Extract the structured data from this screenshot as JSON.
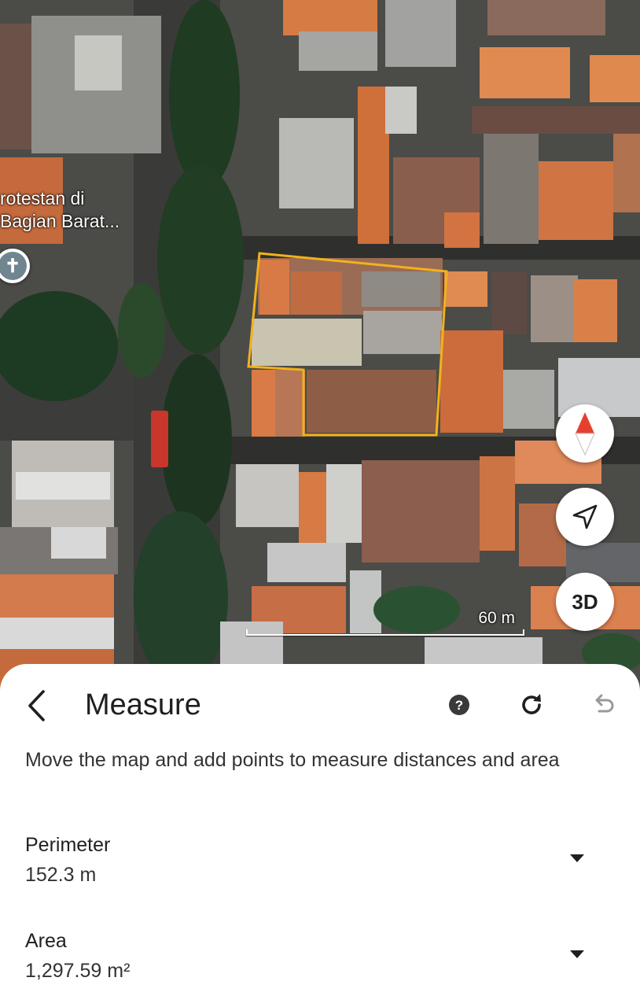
{
  "map": {
    "place_label_line1": "rotestan di",
    "place_label_line2": "Bagian Barat...",
    "pin_icon": "cross-icon",
    "scale_label": "60 m",
    "three_d_label": "3D",
    "measure_outline_color": "#f2b21b"
  },
  "sheet": {
    "title": "Measure",
    "instructions": "Move the map and add points to measure distances and area",
    "perimeter": {
      "label": "Perimeter",
      "value": "152.3 m"
    },
    "area": {
      "label": "Area",
      "value": "1,297.59 m²"
    }
  }
}
